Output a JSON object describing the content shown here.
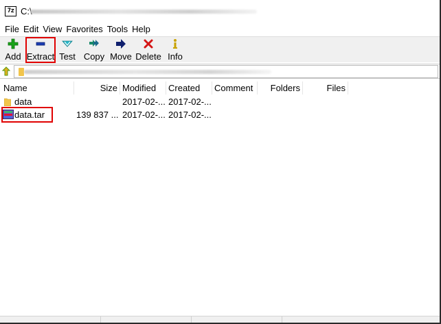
{
  "window": {
    "title_prefix": "C:\\"
  },
  "menu": [
    "File",
    "Edit",
    "View",
    "Favorites",
    "Tools",
    "Help"
  ],
  "toolbar": {
    "buttons": [
      {
        "label": "Add",
        "icon": "plus-icon",
        "color": "#1aa31a"
      },
      {
        "label": "Extract",
        "icon": "minus-icon",
        "color": "#1d3fb5"
      },
      {
        "label": "Test",
        "icon": "check-chevron-icon",
        "color": "#27b8c9"
      },
      {
        "label": "Copy",
        "icon": "double-arrow-icon",
        "color": "#1a8a6a"
      },
      {
        "label": "Move",
        "icon": "arrow-right-icon",
        "color": "#10206e"
      },
      {
        "label": "Delete",
        "icon": "x-icon",
        "color": "#d41515"
      },
      {
        "label": "Info",
        "icon": "info-icon",
        "color": "#c8a200"
      }
    ]
  },
  "columns": [
    "Name",
    "Size",
    "Modified",
    "Created",
    "Comment",
    "Folders",
    "Files"
  ],
  "files": [
    {
      "name": "data",
      "size": "",
      "modified": "2017-02-...",
      "created": "2017-02-...",
      "type": "folder"
    },
    {
      "name": "data.tar",
      "size": "139 837 ...",
      "modified": "2017-02-...",
      "created": "2017-02-...",
      "type": "archive"
    }
  ],
  "colors": {
    "highlight": "#e00000",
    "folder": "#f2c54b"
  }
}
